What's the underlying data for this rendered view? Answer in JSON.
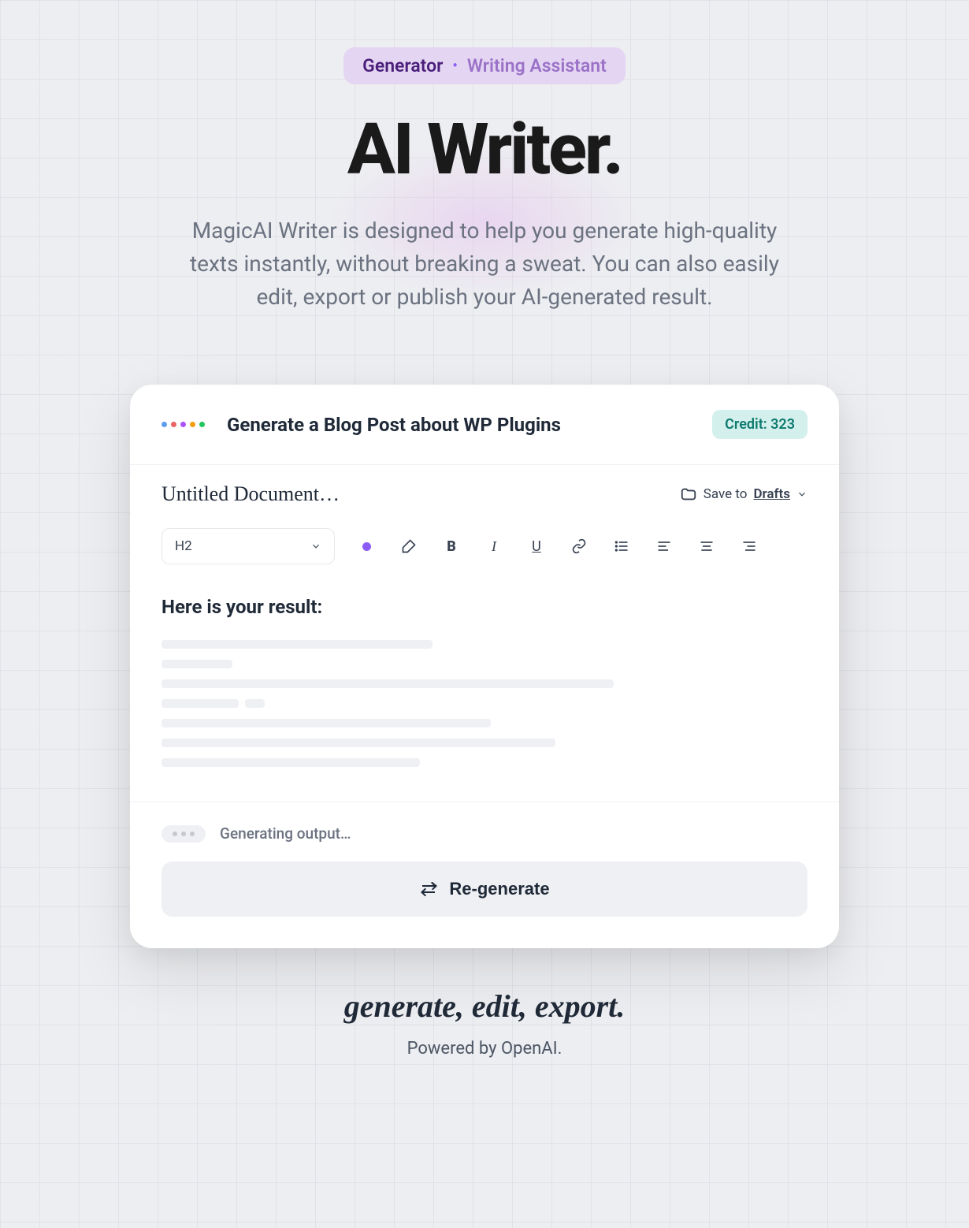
{
  "header": {
    "badge_generator": "Generator",
    "badge_dot": "•",
    "badge_assistant": "Writing Assistant",
    "title": "AI Writer.",
    "subtitle": "MagicAI Writer is designed to help you generate high-quality texts instantly, without breaking a sweat. You can also easily edit, export or publish your AI-generated result."
  },
  "editor": {
    "prompt_title": "Generate a Blog Post about WP Plugins",
    "credit_label": "Credit: 323",
    "doc_title": "Untitled Document…",
    "save_prefix": "Save to ",
    "save_target": "Drafts",
    "heading_select": "H2",
    "result_heading": "Here is your result:",
    "generating_text": "Generating output…",
    "regenerate_label": "Re-generate"
  },
  "footer": {
    "tagline": "generate, edit, export.",
    "powered": "Powered by OpenAI."
  }
}
